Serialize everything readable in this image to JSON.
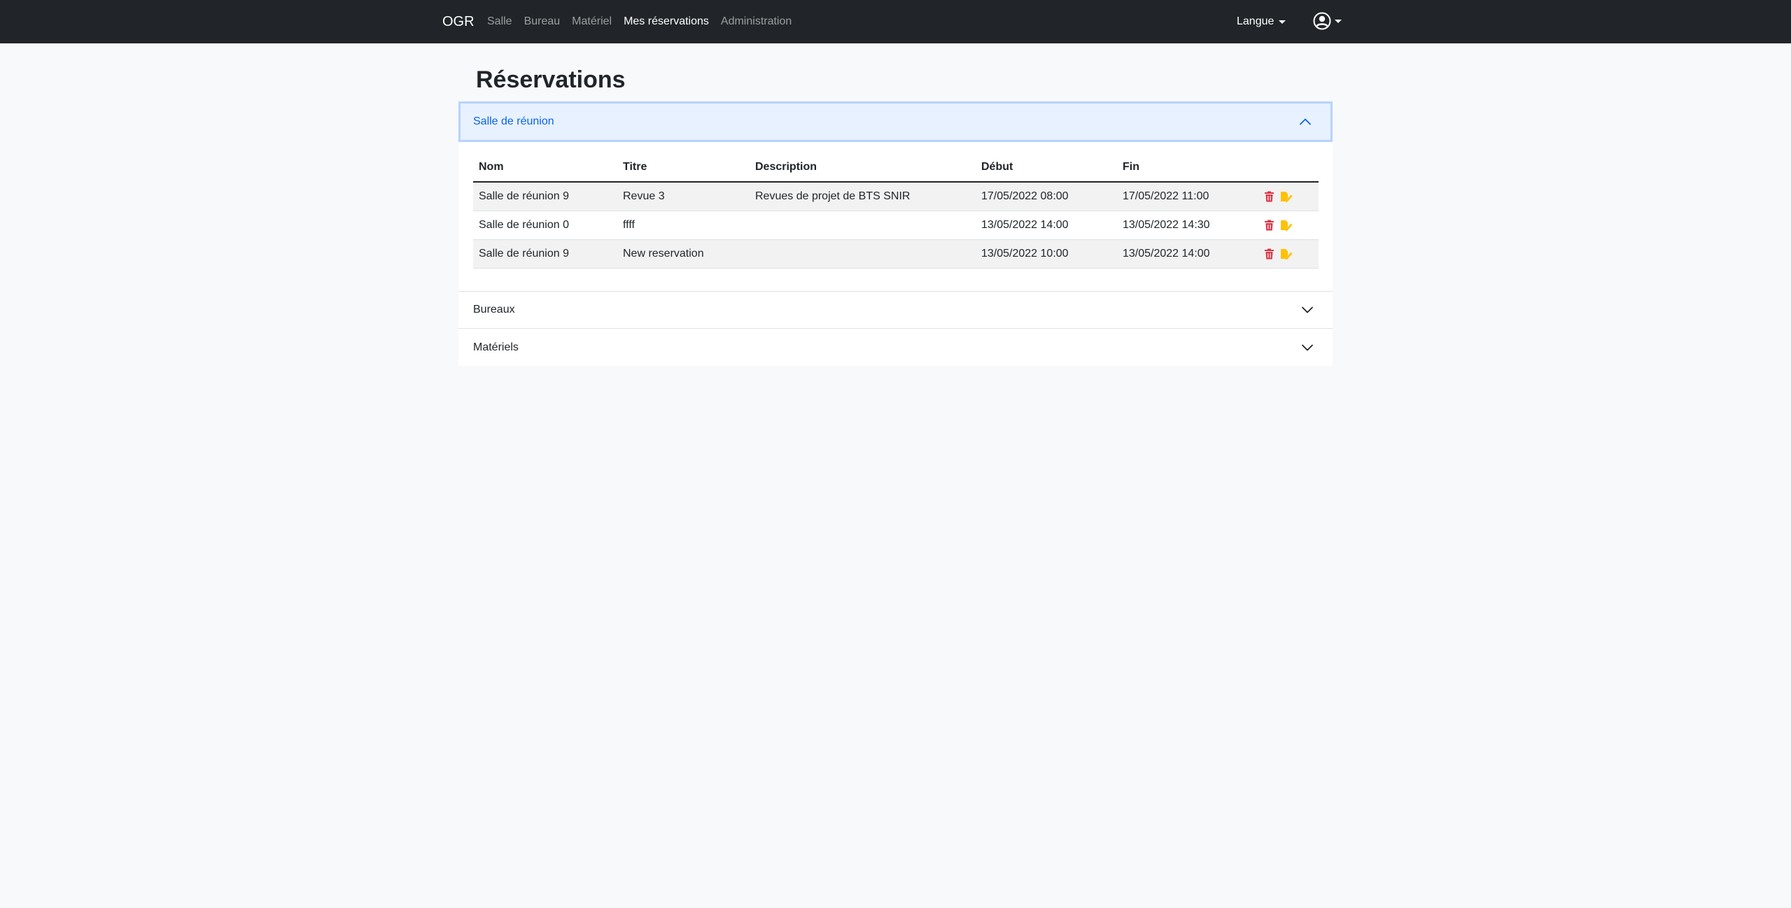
{
  "navbar": {
    "brand": "OGR",
    "links": [
      {
        "label": "Salle",
        "active": false
      },
      {
        "label": "Bureau",
        "active": false
      },
      {
        "label": "Matériel",
        "active": false
      },
      {
        "label": "Mes réservations",
        "active": true
      },
      {
        "label": "Administration",
        "active": false
      }
    ],
    "language_label": "Langue",
    "user_icon": "user-circle-icon"
  },
  "page": {
    "title": "Réservations"
  },
  "accordion": {
    "sections": [
      {
        "label": "Salle de réunion",
        "expanded": true,
        "table": {
          "headers": [
            "Nom",
            "Titre",
            "Description",
            "Début",
            "Fin"
          ],
          "rows": [
            [
              "Salle de réunion 9",
              "Revue 3",
              "Revues de projet de BTS SNIR",
              "17/05/2022 08:00",
              "17/05/2022 11:00"
            ],
            [
              "Salle de réunion 0",
              "ffff",
              "",
              "13/05/2022 14:00",
              "13/05/2022 14:30"
            ],
            [
              "Salle de réunion 9",
              "New reservation",
              "",
              "13/05/2022 10:00",
              "13/05/2022 14:00"
            ]
          ]
        }
      },
      {
        "label": "Bureaux",
        "expanded": false
      },
      {
        "label": "Matériels",
        "expanded": false
      }
    ]
  },
  "colors": {
    "navbar_bg": "#212529",
    "accordion_active_bg": "#e7f1ff",
    "accordion_active_text": "#0c63e4",
    "delete_icon": "#dc3545",
    "edit_icon": "#ffc107"
  },
  "icons": {
    "delete": "trash-icon",
    "edit": "edit-icon",
    "expanded": "chevron-up-icon",
    "collapsed": "chevron-down-icon"
  }
}
